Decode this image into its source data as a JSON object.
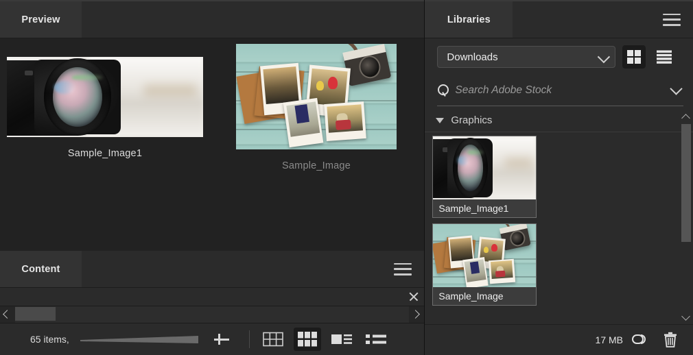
{
  "left_panels": {
    "preview": {
      "tab_label": "Preview",
      "items": [
        {
          "label": "Sample_Image1",
          "icon": "camera-lens-photo"
        },
        {
          "label": "Sample_Image",
          "icon": "polaroids-on-wood-photo"
        }
      ]
    },
    "content": {
      "tab_label": "Content",
      "menu_icon": "hamburger-icon",
      "close_icon": "close-icon",
      "scroll_left_icon": "chevron-left-icon",
      "scroll_right_icon": "chevron-right-icon"
    },
    "status": {
      "items_text": "65 items,",
      "thumbnail_slider_icon": "thumbnail-size-slider",
      "add_icon": "plus-icon",
      "view_modes": [
        {
          "name": "grid-view-outline",
          "label": "Grid view",
          "selected": false
        },
        {
          "name": "thumbnail-view",
          "label": "Thumbnail view",
          "selected": true
        },
        {
          "name": "details-view",
          "label": "Details view",
          "selected": false
        },
        {
          "name": "list-view",
          "label": "List view",
          "selected": false
        }
      ]
    }
  },
  "libraries": {
    "tab_label": "Libraries",
    "menu_icon": "hamburger-icon",
    "library_select": {
      "value": "Downloads",
      "chevron_icon": "chevron-down-icon"
    },
    "view_toggle": [
      {
        "name": "grid-view-button",
        "selected": true
      },
      {
        "name": "list-view-button",
        "selected": false
      }
    ],
    "search": {
      "placeholder": "Search Adobe Stock",
      "icon": "search-icon",
      "chevron_icon": "chevron-down-icon"
    },
    "sections": [
      {
        "title": "Graphics",
        "expanded": true,
        "disclosure_icon": "triangle-down-icon",
        "assets": [
          {
            "label": "Sample_Image1",
            "icon": "camera-lens-thumbnail",
            "selected": true
          },
          {
            "label": "Sample_Image",
            "icon": "polaroids-thumbnail",
            "selected": true
          }
        ]
      }
    ],
    "scrollbar": {
      "up_icon": "scroll-up-arrow-icon",
      "down_icon": "scroll-down-arrow-icon"
    },
    "status": {
      "size_text": "17 MB",
      "cloud_icon": "creative-cloud-icon",
      "delete_icon": "trash-icon"
    }
  },
  "colors": {
    "panel_bg": "#2b2b2b",
    "panel_dark": "#222222",
    "tab_bg": "#333333",
    "text": "#dcdcdc",
    "text_dim": "#8a8a8a",
    "selected_bg": "#1b1b1b"
  }
}
